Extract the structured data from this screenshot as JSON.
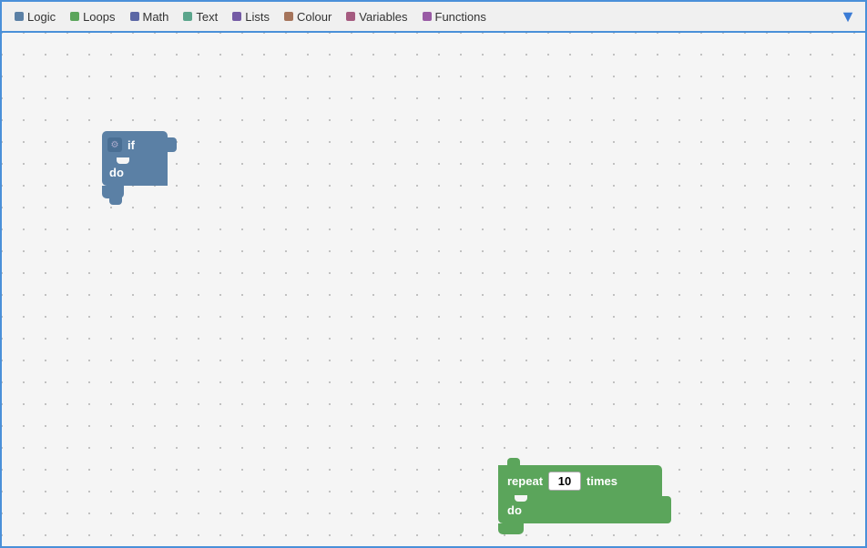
{
  "toolbar": {
    "items": [
      {
        "label": "Logic",
        "color": "#5b80a5",
        "id": "logic"
      },
      {
        "label": "Loops",
        "color": "#5ba55b",
        "id": "loops"
      },
      {
        "label": "Math",
        "color": "#5b67a5",
        "id": "math"
      },
      {
        "label": "Text",
        "color": "#5ba58c",
        "id": "text"
      },
      {
        "label": "Lists",
        "color": "#745ba5",
        "id": "lists"
      },
      {
        "label": "Colour",
        "color": "#a5745b",
        "id": "colour"
      },
      {
        "label": "Variables",
        "color": "#a55b80",
        "id": "variables"
      },
      {
        "label": "Functions",
        "color": "#995ba5",
        "id": "functions"
      }
    ],
    "down_arrow": "▼"
  },
  "blocks": {
    "if_block": {
      "if_label": "if",
      "do_label": "do"
    },
    "repeat_block": {
      "repeat_label": "repeat",
      "value": "10",
      "times_label": "times",
      "do_label": "do"
    }
  }
}
